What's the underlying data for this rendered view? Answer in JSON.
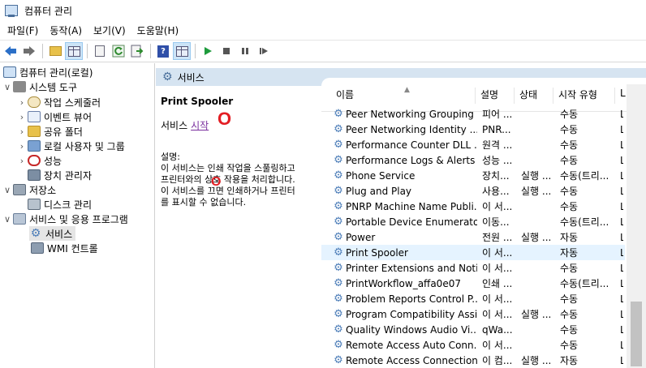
{
  "window": {
    "title": "컴퓨터 관리"
  },
  "menu": [
    "파일(F)",
    "동작(A)",
    "보기(V)",
    "도움말(H)"
  ],
  "toolbar": {
    "icons": [
      "back-arrow-icon",
      "forward-arrow-icon",
      "up-folder-icon",
      "show-hide-tree-icon",
      "properties-icon",
      "refresh-icon",
      "export-icon",
      "help-icon",
      "show-hide-action-icon",
      "play-icon",
      "stop-icon",
      "pause-icon",
      "restart-icon"
    ]
  },
  "tree": {
    "root": "컴퓨터 관리(로컬)",
    "items": [
      {
        "label": "시스템 도구",
        "level": 1,
        "expanded": true
      },
      {
        "label": "작업 스케줄러",
        "level": 2
      },
      {
        "label": "이벤트 뷰어",
        "level": 2
      },
      {
        "label": "공유 폴더",
        "level": 2
      },
      {
        "label": "로컬 사용자 및 그룹",
        "level": 2
      },
      {
        "label": "성능",
        "level": 2
      },
      {
        "label": "장치 관리자",
        "level": 2
      },
      {
        "label": "저장소",
        "level": 1,
        "expanded": true
      },
      {
        "label": "디스크 관리",
        "level": 2
      },
      {
        "label": "서비스 및 응용 프로그램",
        "level": 1,
        "expanded": true
      },
      {
        "label": "서비스",
        "level": 2,
        "selected": true
      },
      {
        "label": "WMI 컨트롤",
        "level": 2
      }
    ]
  },
  "panel": {
    "header": "서비스"
  },
  "description": {
    "service_name": "Print Spooler",
    "action_prefix": "서비스",
    "action_link": "시작",
    "label": "설명:",
    "lines": [
      "이 서비스는 인쇄 작업을 스풀링하고",
      "프린터와의 상호 작용을 처리합니다.",
      "이 서비스를 끄면 인쇄하거나 프린터",
      "를 표시할 수 없습니다."
    ],
    "annotation_mark": "O"
  },
  "columns": [
    "이름",
    "설명",
    "상태",
    "시작 유형",
    "L"
  ],
  "services": [
    {
      "name": "Peer Networking Grouping",
      "desc": "피어 ...",
      "status": "",
      "startup": "수동",
      "logon": "L"
    },
    {
      "name": "Peer Networking Identity ...",
      "desc": "PNR...",
      "status": "",
      "startup": "수동",
      "logon": "L"
    },
    {
      "name": "Performance Counter DLL ...",
      "desc": "원격 ...",
      "status": "",
      "startup": "수동",
      "logon": "L"
    },
    {
      "name": "Performance Logs & Alerts",
      "desc": "성능 ...",
      "status": "",
      "startup": "수동",
      "logon": "L"
    },
    {
      "name": "Phone Service",
      "desc": "장치...",
      "status": "실행 ...",
      "startup": "수동(트리...",
      "logon": "L"
    },
    {
      "name": "Plug and Play",
      "desc": "사용...",
      "status": "실행 ...",
      "startup": "수동",
      "logon": "L"
    },
    {
      "name": "PNRP Machine Name Publi...",
      "desc": "이 서...",
      "status": "",
      "startup": "수동",
      "logon": "L"
    },
    {
      "name": "Portable Device Enumerato...",
      "desc": "이동...",
      "status": "",
      "startup": "수동(트리...",
      "logon": "L"
    },
    {
      "name": "Power",
      "desc": "전원 ...",
      "status": "실행 ...",
      "startup": "자동",
      "logon": "L"
    },
    {
      "name": "Print Spooler",
      "desc": "이 서...",
      "status": "",
      "startup": "자동",
      "logon": "L",
      "selected": true
    },
    {
      "name": "Printer Extensions and Noti...",
      "desc": "이 서...",
      "status": "",
      "startup": "수동",
      "logon": "L"
    },
    {
      "name": "PrintWorkflow_affa0e07",
      "desc": "인쇄 ...",
      "status": "",
      "startup": "수동(트리...",
      "logon": "L"
    },
    {
      "name": "Problem Reports Control P...",
      "desc": "이 서...",
      "status": "",
      "startup": "수동",
      "logon": "L"
    },
    {
      "name": "Program Compatibility Assi...",
      "desc": "이 서...",
      "status": "실행 ...",
      "startup": "수동",
      "logon": "L"
    },
    {
      "name": "Quality Windows Audio Vi...",
      "desc": "qWa...",
      "status": "",
      "startup": "수동",
      "logon": "L"
    },
    {
      "name": "Remote Access Auto Conn...",
      "desc": "이 서...",
      "status": "",
      "startup": "수동",
      "logon": "L"
    },
    {
      "name": "Remote Access Connection...",
      "desc": "이 컴...",
      "status": "실행 ...",
      "startup": "자동",
      "logon": "L"
    }
  ]
}
